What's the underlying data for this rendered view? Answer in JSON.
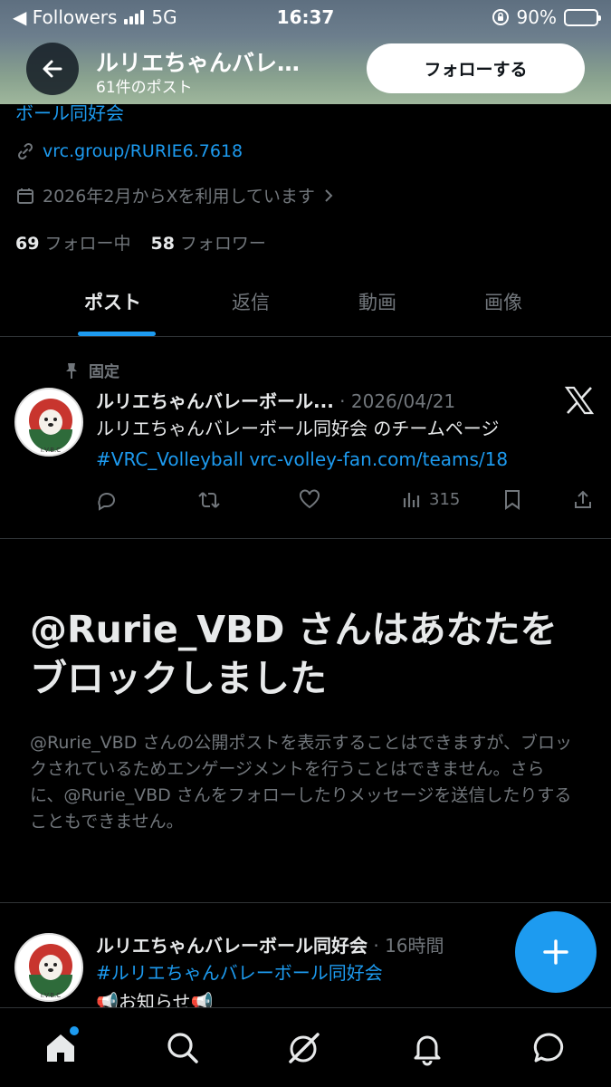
{
  "status_bar": {
    "back_app": "◀ Followers",
    "network": "5G",
    "time": "16:37",
    "battery": "90%",
    "battery_level": 0.9
  },
  "header": {
    "title": "ルリエちゃんバレ…",
    "post_count": "61件のポスト",
    "follow_label": "フォローする"
  },
  "profile": {
    "bio_tail": "ボール同好会",
    "link": "vrc.group/RURIE6.7618",
    "joined": "2026年2月からXを利用しています",
    "following_count": "69",
    "following_label": "フォロー中",
    "followers_count": "58",
    "followers_label": "フォロワー"
  },
  "tabs": [
    {
      "label": "ポスト",
      "active": true
    },
    {
      "label": "返信",
      "active": false
    },
    {
      "label": "動画",
      "active": false
    },
    {
      "label": "画像",
      "active": false
    }
  ],
  "pinned_post": {
    "pinned_label": "固定",
    "name": "ルリエちゃんバレーボール...",
    "separator": "·",
    "date": "2026/04/21",
    "line1": "ルリエちゃんバレーボール同好会 のチームページ",
    "hashtag": "#VRC_Volleyball",
    "link": "vrc-volley-fan.com/teams/18",
    "views": "315",
    "avatar_text": "I.V.B.C"
  },
  "block_notice": {
    "title": "@Rurie_VBD さんはあなたをブロックしました",
    "description": "@Rurie_VBD さんの公開ポストを表示することはできますが、ブロックされているためエンゲージメントを行うことはできません。さらに、@Rurie_VBD さんをフォローしたりメッセージを送信したりすることもできません。"
  },
  "post2": {
    "name": "ルリエちゃんバレーボール同好会",
    "separator": "·",
    "time": "16時間",
    "hashtag": "#ルリエちゃんバレーボール同好会",
    "body": "📢お知らせ📢",
    "avatar_text": "I.V.B.C"
  },
  "colors": {
    "accent": "#1d9bf0",
    "background": "#000000",
    "muted": "#71767b",
    "text": "#e7e9ea"
  },
  "icons": {
    "fab": "plus-icon",
    "nav": [
      "home-icon",
      "search-icon",
      "grok-icon",
      "bell-icon",
      "message-icon"
    ]
  }
}
